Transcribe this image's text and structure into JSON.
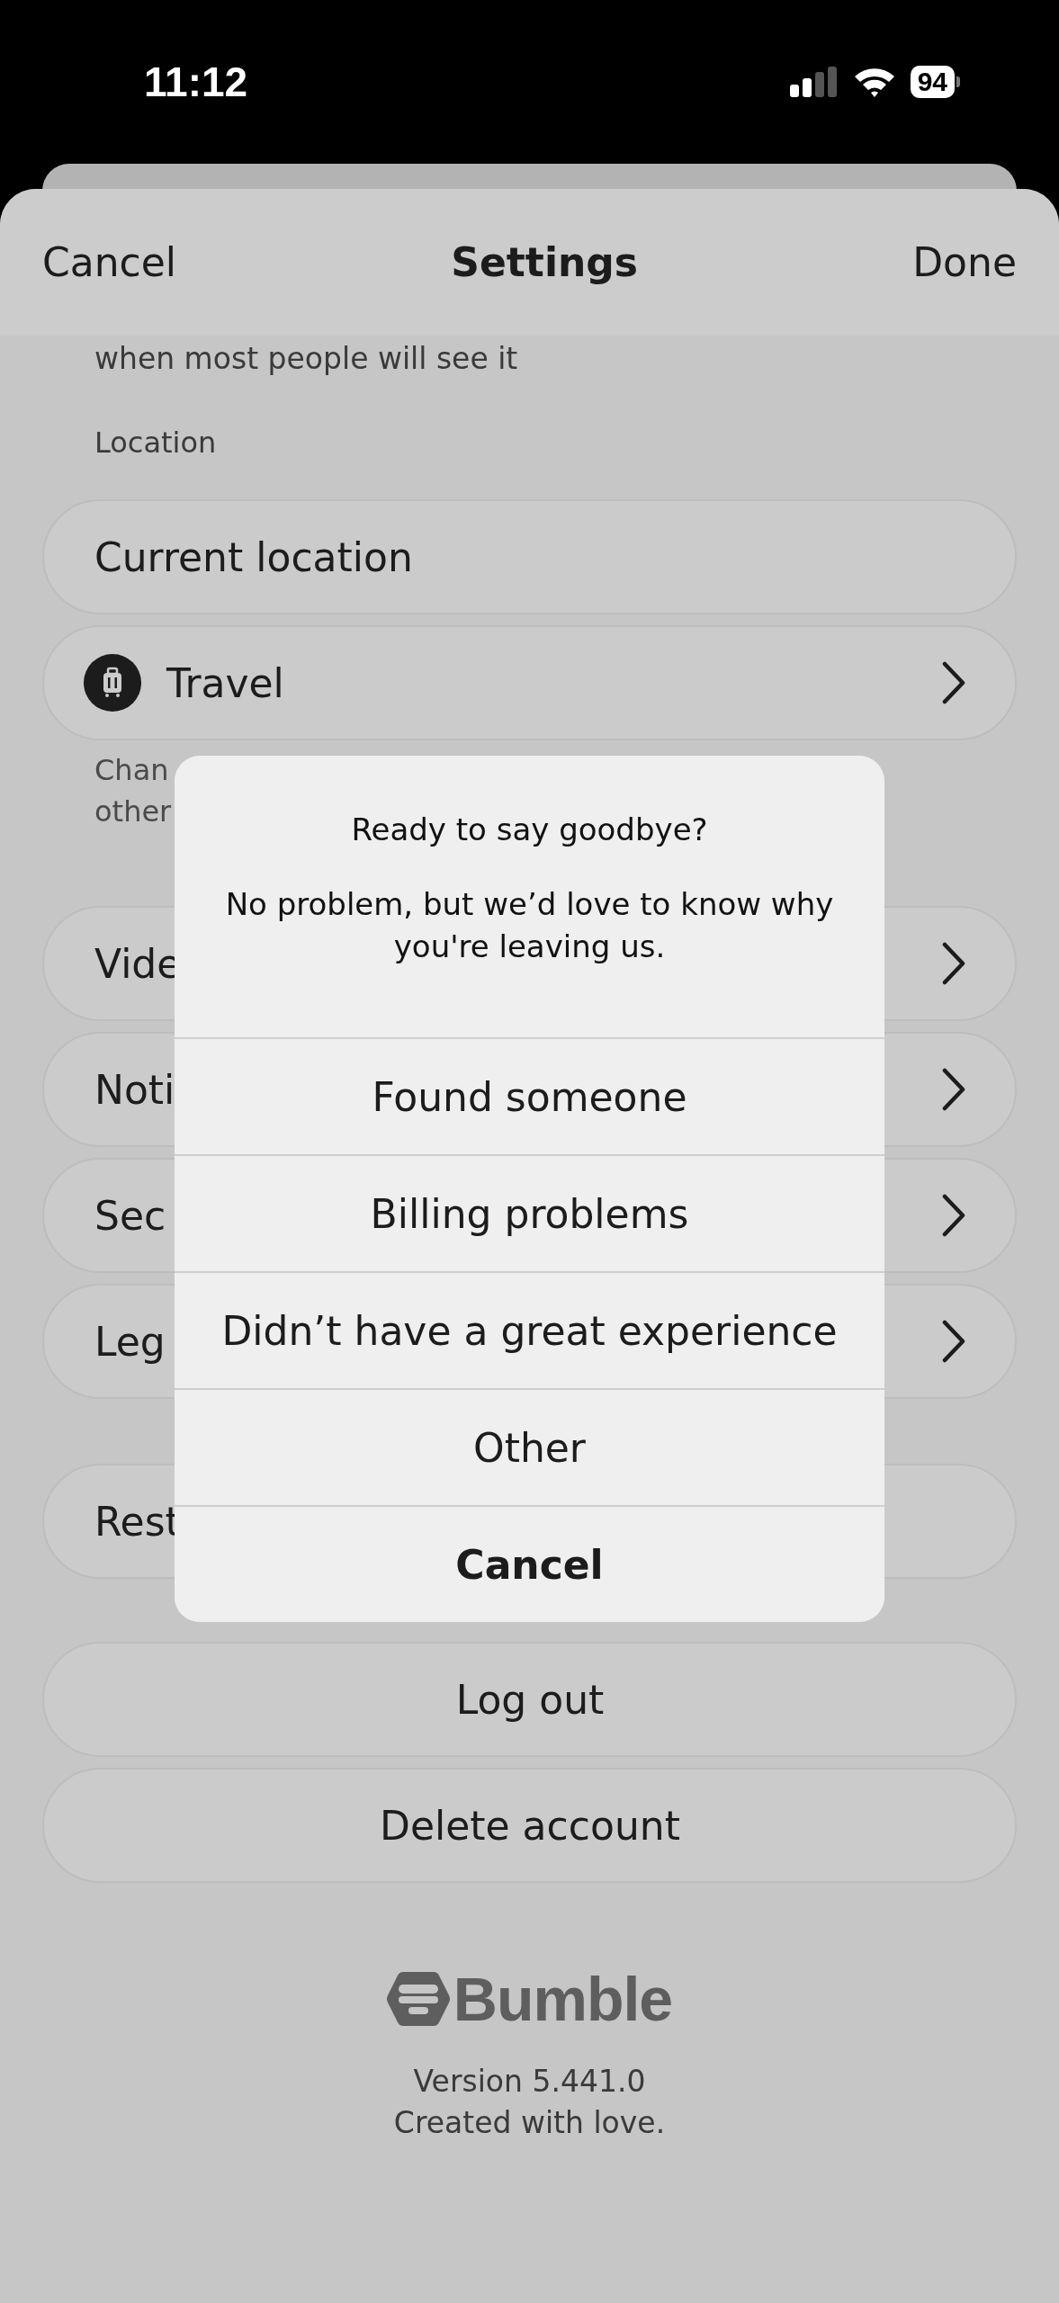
{
  "status_bar": {
    "time": "11:12",
    "battery": "94"
  },
  "header": {
    "cancel": "Cancel",
    "title": "Settings",
    "done": "Done"
  },
  "settings": {
    "caption": "when most people will see it",
    "location_label": "Location",
    "location_rows": [
      {
        "label": "Current location",
        "kind": "plain"
      },
      {
        "label": "Travel",
        "kind": "travel"
      }
    ],
    "location_hint": [
      "Chan",
      "other"
    ],
    "menu_rows": [
      {
        "label": "Vide",
        "chevron": true
      },
      {
        "label": "Noti",
        "chevron": true
      },
      {
        "label": "Sec",
        "chevron": true
      },
      {
        "label": "Leg",
        "chevron": true
      }
    ],
    "extra_rows": [
      {
        "label": "Rest",
        "chevron": false
      }
    ],
    "account_buttons": [
      "Log out",
      "Delete account"
    ]
  },
  "footer": {
    "logo": "Bumble",
    "version": "Version 5.441.0",
    "tagline": "Created with love."
  },
  "dialog": {
    "title": "Ready to say goodbye?",
    "message": "No problem, but we’d love to know why you're leaving us.",
    "options": [
      {
        "label": "Found someone",
        "kind": "option"
      },
      {
        "label": "Billing problems",
        "kind": "option"
      },
      {
        "label": "Didn’t have a great experience",
        "kind": "option"
      },
      {
        "label": "Other",
        "kind": "option"
      },
      {
        "label": "Cancel",
        "kind": "cancel"
      }
    ]
  }
}
